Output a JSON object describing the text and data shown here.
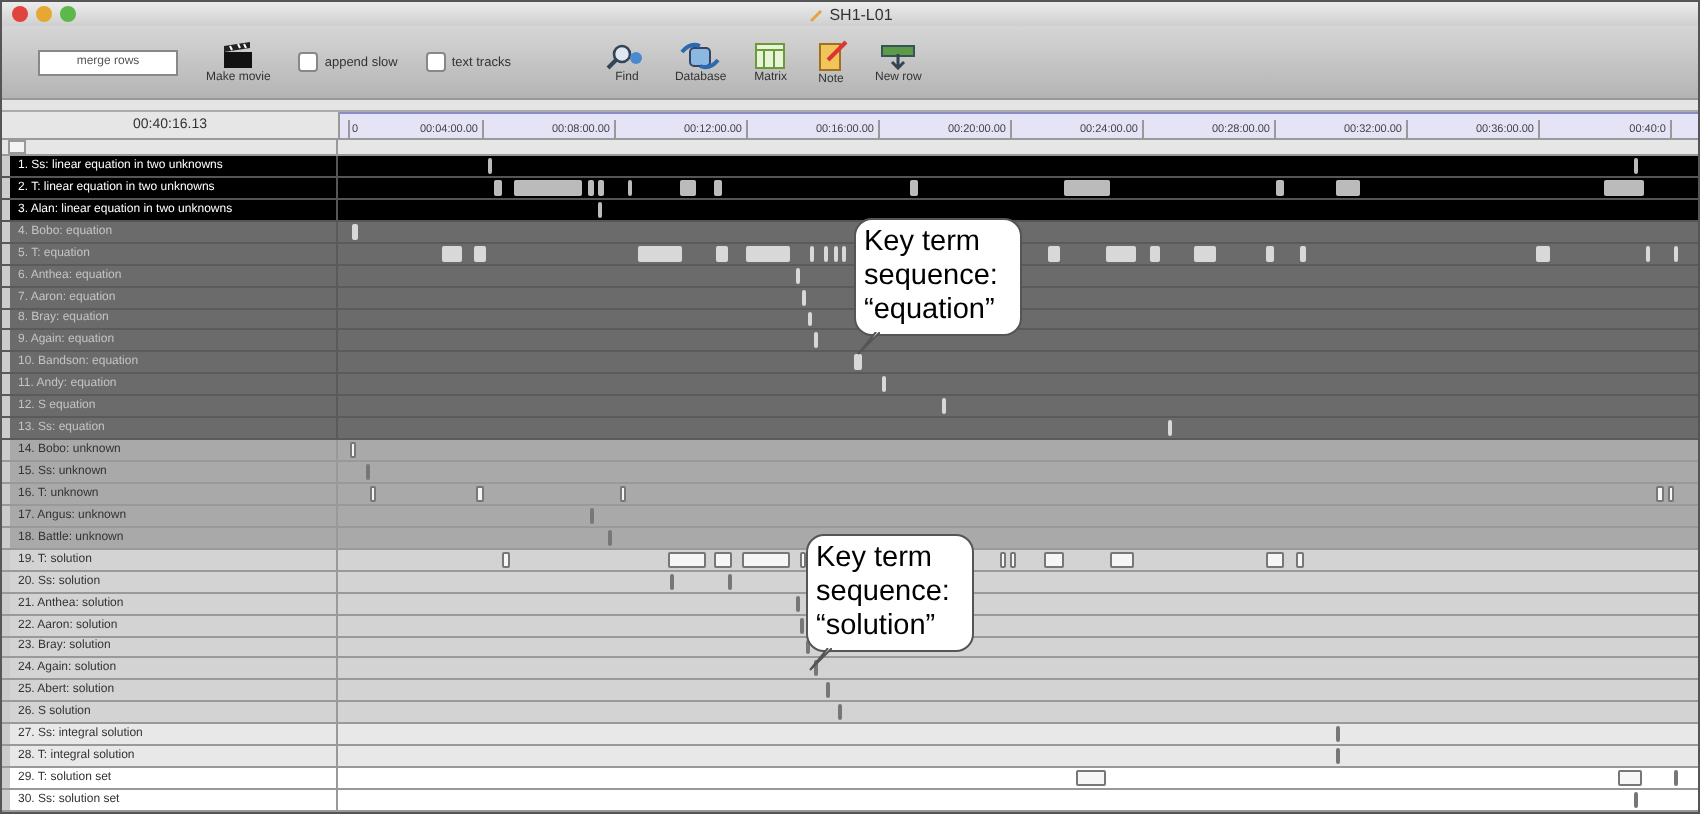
{
  "window": {
    "title": "SH1-L01"
  },
  "toolbar": {
    "merge_field": {
      "value": "merge rows"
    },
    "make_movie": {
      "label": "Make movie"
    },
    "checkboxes": [
      {
        "label": "append slow",
        "checked": false
      },
      {
        "label": "text tracks",
        "checked": false
      }
    ],
    "tools": [
      {
        "kind": "find",
        "label": "Find"
      },
      {
        "kind": "database",
        "label": "Database"
      },
      {
        "kind": "matrix",
        "label": "Matrix"
      },
      {
        "kind": "note",
        "label": "Note"
      },
      {
        "kind": "new_row",
        "label": "New row"
      }
    ]
  },
  "timeline": {
    "current_time": "00:40:16.13",
    "ruler_labels": [
      "0",
      "00:04:00.00",
      "00:08:00.00",
      "00:12:00.00",
      "00:16:00.00",
      "00:20:00.00",
      "00:24:00.00",
      "00:28:00.00",
      "00:32:00.00",
      "00:36:00.00",
      "00:40:0"
    ]
  },
  "rows": [
    {
      "label": "1. Ss: linear equation in two unknowns",
      "color": "#000000"
    },
    {
      "label": "2. T: linear equation in two unknowns",
      "color": "#000000"
    },
    {
      "label": "3. Alan: linear equation in two unknowns",
      "color": "#000000"
    },
    {
      "label": "4. Bobo: equation",
      "color": "#6b6b6b"
    },
    {
      "label": "5. T: equation",
      "color": "#6b6b6b"
    },
    {
      "label": "6. Anthea: equation",
      "color": "#6b6b6b"
    },
    {
      "label": "7. Aaron: equation",
      "color": "#6b6b6b"
    },
    {
      "label": "8. Bray: equation",
      "color": "#6b6b6b"
    },
    {
      "label": "9. Again: equation",
      "color": "#6b6b6b"
    },
    {
      "label": "10. Bandson: equation",
      "color": "#6b6b6b"
    },
    {
      "label": "11. Andy: equation",
      "color": "#6b6b6b"
    },
    {
      "label": "12. S equation",
      "color": "#6b6b6b"
    },
    {
      "label": "13. Ss: equation",
      "color": "#6b6b6b"
    },
    {
      "label": "14. Bobo: unknown",
      "color": "#a9a9a9"
    },
    {
      "label": "15. Ss: unknown",
      "color": "#a9a9a9"
    },
    {
      "label": "16. T: unknown",
      "color": "#a9a9a9"
    },
    {
      "label": "17. Angus: unknown",
      "color": "#a9a9a9"
    },
    {
      "label": "18. Battle: unknown",
      "color": "#a9a9a9"
    },
    {
      "label": "19. T: solution",
      "color": "#d3d3d3"
    },
    {
      "label": "20. Ss: solution",
      "color": "#d3d3d3"
    },
    {
      "label": "21. Anthea: solution",
      "color": "#d3d3d3"
    },
    {
      "label": "22. Aaron: solution",
      "color": "#d3d3d3"
    },
    {
      "label": "23. Bray: solution",
      "color": "#d3d3d3"
    },
    {
      "label": "24. Again: solution",
      "color": "#d3d3d3"
    },
    {
      "label": "25. Abert: solution",
      "color": "#d3d3d3"
    },
    {
      "label": "26. S solution",
      "color": "#d3d3d3"
    },
    {
      "label": "27. Ss: integral solution",
      "color": "#e8e8e8"
    },
    {
      "label": "28. T: integral solution",
      "color": "#e8e8e8"
    },
    {
      "label": "29. T: solution set",
      "color": "#ffffff"
    },
    {
      "label": "30. Ss: solution set",
      "color": "#ffffff"
    }
  ],
  "callouts": [
    {
      "text": "Key term sequence: “equation”"
    },
    {
      "text": "Key term sequence: “solution”"
    }
  ]
}
